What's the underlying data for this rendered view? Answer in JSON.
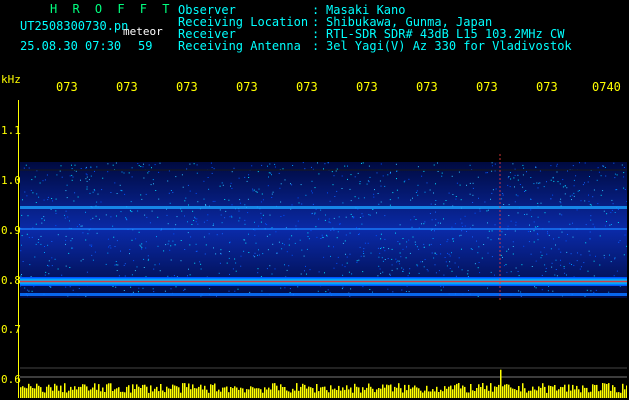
{
  "header": {
    "brand": "H R O F F T",
    "file_name": "UT2508300730.pn",
    "mode": "meteor",
    "date_time": "25.08.30 07:30",
    "count": "59"
  },
  "info": [
    {
      "label": "Observer",
      "value": "Masaki Kano"
    },
    {
      "label": "Receiving Location",
      "value": "Shibukawa, Gunma, Japan"
    },
    {
      "label": "Receiver",
      "value": "RTL-SDR SDR# 43dB L15 103.2MHz CW"
    },
    {
      "label": "Receiving Antenna",
      "value": "3el Yagi(V) Az 330 for Vladivostok"
    }
  ],
  "axis": {
    "unit": "kHz",
    "y_ticks": [
      "1.1",
      "1.0",
      "0.9",
      "0.8",
      "0.7",
      "0.6"
    ],
    "x_ticks": [
      "073",
      "073",
      "073",
      "073",
      "073",
      "073",
      "073",
      "073",
      "073",
      "0740"
    ]
  },
  "colors": {
    "background": "#000000",
    "text_cyan": "#00ffff",
    "text_yellow": "#ffff00",
    "brand_green": "#00ff7f",
    "noise_blue": "#0033cc",
    "echo_red": "#ff2020",
    "bar_yellow": "#ffff00"
  }
}
